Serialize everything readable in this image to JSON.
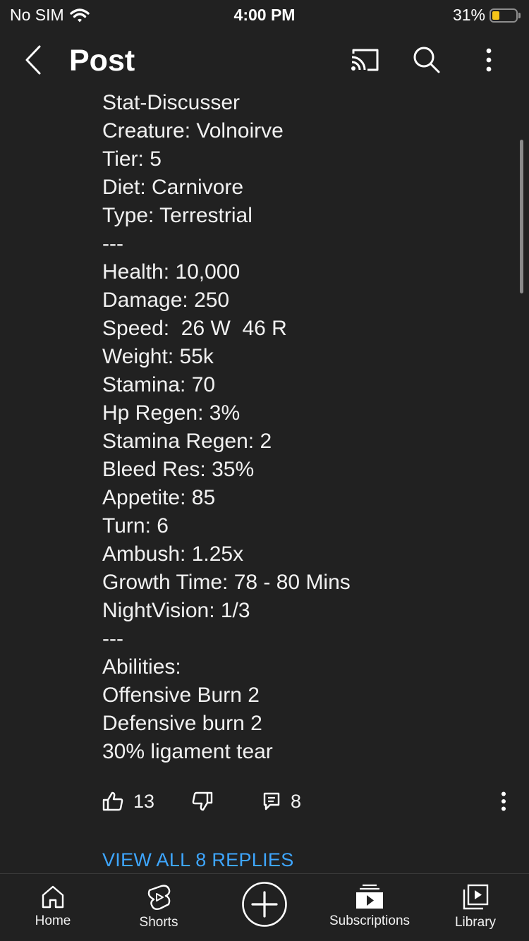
{
  "status_bar": {
    "carrier": "No SIM",
    "time": "4:00 PM",
    "battery_percent": "31%",
    "battery_level": 0.31,
    "battery_color": "#f5c518"
  },
  "header": {
    "title": "Post",
    "icons": [
      "back-icon",
      "cast-icon",
      "search-icon",
      "more-vert-icon"
    ]
  },
  "post": {
    "lines": [
      "Stat-Discusser",
      "Creature: Volnoirve",
      "Tier: 5",
      "Diet: Carnivore",
      "Type: Terrestrial",
      "---",
      "Health: 10,000",
      "Damage: 250",
      "Speed:  26 W  46 R",
      "Weight: 55k",
      "Stamina: 70",
      "Hp Regen: 3%",
      "Stamina Regen: 2",
      "Bleed Res: 35%",
      "Appetite: 85",
      "Turn: 6",
      "Ambush: 1.25x",
      "Growth Time: 78 - 80 Mins",
      "NightVision: 1/3",
      "---",
      "Abilities:",
      "Offensive Burn 2",
      "Defensive burn 2",
      "30% ligament tear"
    ]
  },
  "actions": {
    "likes": "13",
    "replies": "8",
    "view_replies": "VIEW ALL 8 REPLIES",
    "link_color": "#3ea6ff"
  },
  "bottom_nav": {
    "home": "Home",
    "shorts": "Shorts",
    "subscriptions": "Subscriptions",
    "library": "Library"
  }
}
